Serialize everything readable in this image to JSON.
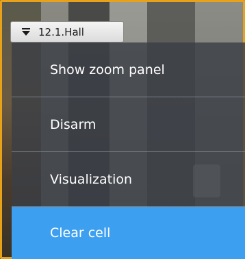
{
  "camera": {
    "title": "12.1.Hall",
    "toggle_icon": "collapse-triangle-icon"
  },
  "menu": {
    "items": [
      {
        "label": "Show zoom panel"
      },
      {
        "label": "Disarm"
      },
      {
        "label": "Visualization"
      },
      {
        "label": "Clear cell",
        "selected": true
      }
    ],
    "selected_color": "#3d9ff0"
  },
  "frame": {
    "border_color": "#e8a21a"
  }
}
